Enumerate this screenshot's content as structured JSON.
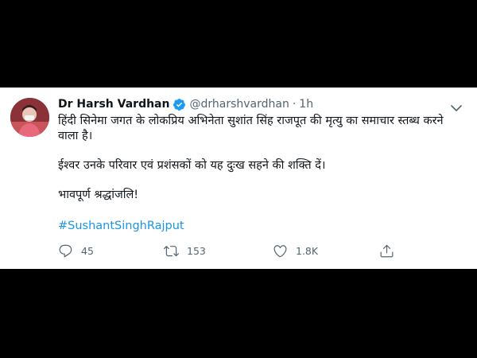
{
  "tweet": {
    "display_name": "Dr Harsh Vardhan",
    "handle": "@drharshvardhan",
    "separator": "·",
    "timestamp": "1h",
    "paragraphs": [
      "हिंदी सिनेमा जगत के लोकप्रिय अभिनेता सुशांत सिंह राजपूत की मृत्यु का समाचार स्तब्ध करने वाला है।",
      "ईश्वर उनके परिवार एवं प्रशंसकों को यह दुःख सहने की शक्ति दें।",
      "भावपूर्ण श्रद्धांजलि!"
    ],
    "hashtag": "#SushantSinghRajput",
    "verified_icon": "verified-badge-icon",
    "accent_color": "#1b95e0"
  },
  "actions": {
    "reply": {
      "icon": "reply-icon",
      "count": "45"
    },
    "retweet": {
      "icon": "retweet-icon",
      "count": "153"
    },
    "like": {
      "icon": "heart-icon",
      "count": "1.8K"
    },
    "share": {
      "icon": "share-icon"
    }
  }
}
